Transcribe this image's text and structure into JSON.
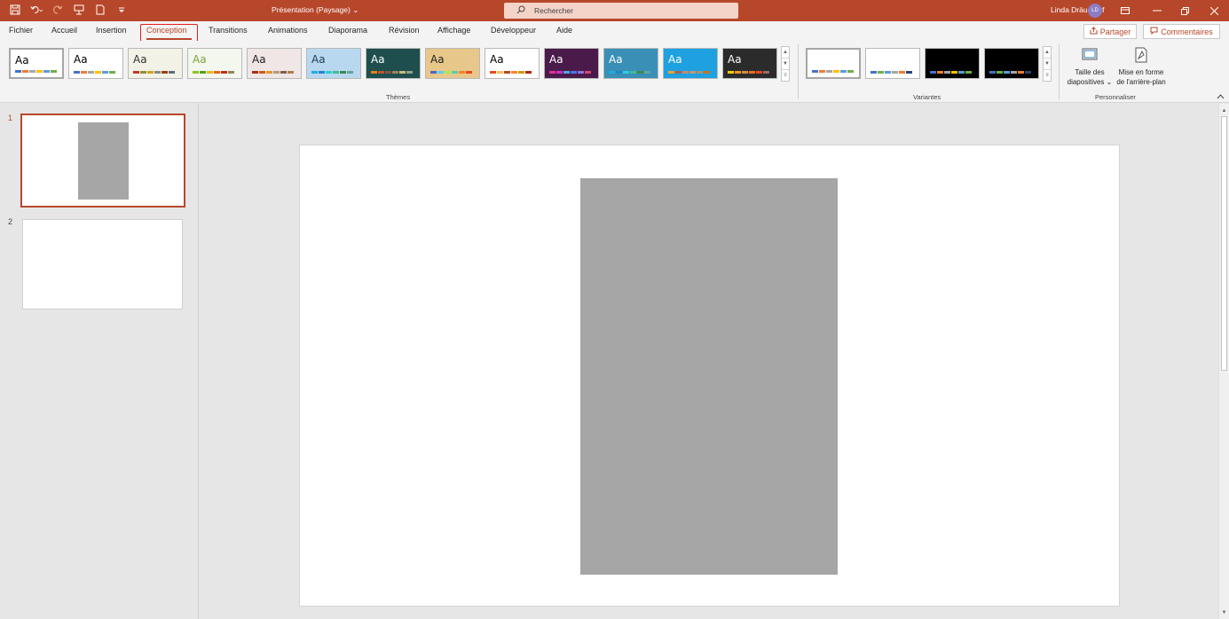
{
  "titlebar": {
    "document_title": "Présentation (Paysage)",
    "document_title_chevron": "⌄",
    "search_label": "Rechercher",
    "user_name": "Linda Dräusdorf",
    "user_initials": "LD"
  },
  "tabs": [
    {
      "label": "Fichier"
    },
    {
      "label": "Accueil"
    },
    {
      "label": "Insertion"
    },
    {
      "label": "Conception",
      "active": true
    },
    {
      "label": "Transitions"
    },
    {
      "label": "Animations"
    },
    {
      "label": "Diaporama"
    },
    {
      "label": "Révision"
    },
    {
      "label": "Affichage"
    },
    {
      "label": "Développeur"
    },
    {
      "label": "Aide"
    }
  ],
  "actions": {
    "share_label": "Partager",
    "comments_label": "Commentaires"
  },
  "ribbon": {
    "themes_group_label": "Thèmes",
    "variants_group_label": "Variantes",
    "customize_group_label": "Personnaliser",
    "theme_sample_text": "Aa",
    "slide_size_label_line1": "Taille des",
    "slide_size_label_line2": "diapositives ⌄",
    "background_format_label_line1": "Mise en forme",
    "background_format_label_line2": "de l'arrière-plan"
  },
  "themes": [
    {
      "bg": "#ffffff",
      "text": "#000000",
      "swatches": [
        "#4472c4",
        "#ed7d31",
        "#a5a5a5",
        "#ffc000",
        "#5b9bd5",
        "#70ad47"
      ]
    },
    {
      "bg": "#ffffff",
      "text": "#000000",
      "swatches": [
        "#4472c4",
        "#ed7d31",
        "#a5a5a5",
        "#ffc000",
        "#5b9bd5",
        "#70ad47"
      ]
    },
    {
      "bg": "#f2f2e6",
      "text": "#333333",
      "swatches": [
        "#c0392b",
        "#8e8e3a",
        "#d4a017",
        "#7f8c8d",
        "#a04000",
        "#5d6d7e"
      ]
    },
    {
      "bg": "#f4f7ee",
      "text": "#7aa23b",
      "swatches": [
        "#90c226",
        "#54a021",
        "#e6b91e",
        "#e76618",
        "#c42f1a",
        "#918655"
      ]
    },
    {
      "bg": "#f0e6e6",
      "text": "#222222",
      "swatches": [
        "#a5300f",
        "#d55816",
        "#e19825",
        "#b19c7d",
        "#7f5f52",
        "#b27d49"
      ]
    },
    {
      "bg": "#b8d8f0",
      "text": "#1f3b5a",
      "swatches": [
        "#1cade4",
        "#2683c6",
        "#27ced7",
        "#42ba97",
        "#3e8853",
        "#62a39f"
      ]
    },
    {
      "bg": "#1f4e4e",
      "text": "#ffffff",
      "swatches": [
        "#e48312",
        "#bd582c",
        "#865640",
        "#9b8357",
        "#c2bc80",
        "#94a088"
      ]
    },
    {
      "bg": "#e8c88a",
      "text": "#222222",
      "swatches": [
        "#4e67c8",
        "#5eccf3",
        "#a7ea52",
        "#5dceaf",
        "#ff8021",
        "#f14124"
      ]
    },
    {
      "bg": "#ffffff",
      "text": "#000000",
      "swatches": [
        "#e84c22",
        "#ffbd47",
        "#b64926",
        "#ff8427",
        "#cc9900",
        "#b22600"
      ]
    },
    {
      "bg": "#4a1a4a",
      "text": "#ffffff",
      "swatches": [
        "#e32d91",
        "#c830cc",
        "#4ea6dc",
        "#4775e7",
        "#8971e1",
        "#d54773"
      ]
    },
    {
      "bg": "#3a8fb7",
      "text": "#ffffff",
      "swatches": [
        "#1cade4",
        "#2683c6",
        "#27ced7",
        "#42ba97",
        "#3e8853",
        "#62a39f"
      ]
    },
    {
      "bg": "#1fa0e0",
      "text": "#ffffff",
      "swatches": [
        "#f0a22e",
        "#a5644e",
        "#b58b80",
        "#c3986d",
        "#a19574",
        "#c17529"
      ]
    },
    {
      "bg": "#2b2b2b",
      "text": "#ffffff",
      "swatches": [
        "#ffca08",
        "#f8931d",
        "#ce8d3e",
        "#ec7016",
        "#e64823",
        "#9c6a6a"
      ]
    }
  ],
  "variants": [
    {
      "bg": "#ffffff",
      "swatches": [
        "#4472c4",
        "#ed7d31",
        "#a5a5a5",
        "#ffc000",
        "#5b9bd5",
        "#70ad47"
      ]
    },
    {
      "bg": "#ffffff",
      "swatches": [
        "#4472c4",
        "#70ad47",
        "#5b9bd5",
        "#a5a5a5",
        "#ed7d31",
        "#264478"
      ]
    },
    {
      "bg": "#000000",
      "swatches": [
        "#4472c4",
        "#ed7d31",
        "#a5a5a5",
        "#ffc000",
        "#5b9bd5",
        "#70ad47"
      ]
    },
    {
      "bg": "#000000",
      "swatches": [
        "#4472c4",
        "#70ad47",
        "#5b9bd5",
        "#a5a5a5",
        "#ed7d31",
        "#264478"
      ]
    }
  ],
  "slides": [
    {
      "number": "1",
      "selected": true
    },
    {
      "number": "2",
      "selected": false
    }
  ],
  "colors": {
    "accent": "#b7472a",
    "shape_fill": "#a6a6a6"
  }
}
